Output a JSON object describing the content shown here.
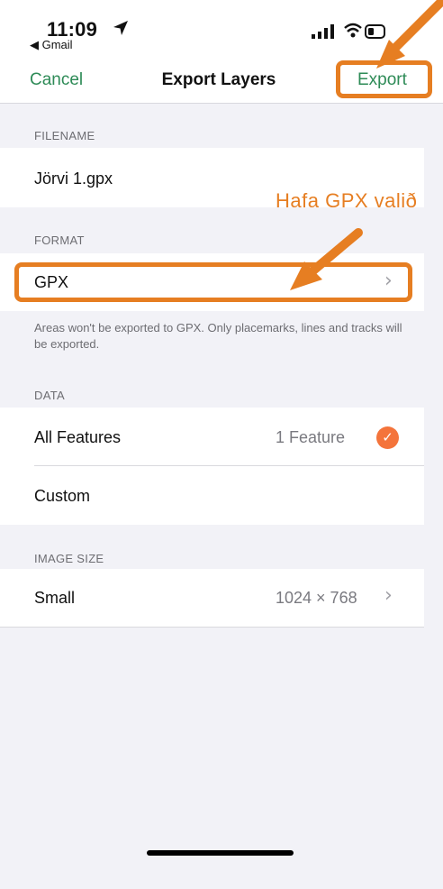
{
  "status_bar": {
    "time": "11:09",
    "back_app": "◀ Gmail"
  },
  "nav": {
    "cancel": "Cancel",
    "title": "Export Layers",
    "export": "Export"
  },
  "sections": {
    "filename_header": "FILENAME",
    "filename_value": "Jörvi 1.gpx",
    "format_header": "FORMAT",
    "format_value": "GPX",
    "format_note": "Areas won't be exported to GPX. Only placemarks, lines and tracks will be exported.",
    "data_header": "DATA",
    "all_features_label": "All Features",
    "all_features_value": "1 Feature",
    "custom_label": "Custom",
    "image_size_header": "IMAGE SIZE",
    "image_size_label": "Small",
    "image_size_value": "1024 × 768"
  },
  "annotation": {
    "text": "Hafa GPX valið",
    "color": "#e67e22"
  },
  "colors": {
    "accent_green": "#2e8b57",
    "check_orange": "#f4743b"
  },
  "icons": [
    "location-arrow-icon",
    "signal-icon",
    "wifi-icon",
    "battery-icon",
    "chevron-right-icon",
    "checkmark-icon"
  ]
}
